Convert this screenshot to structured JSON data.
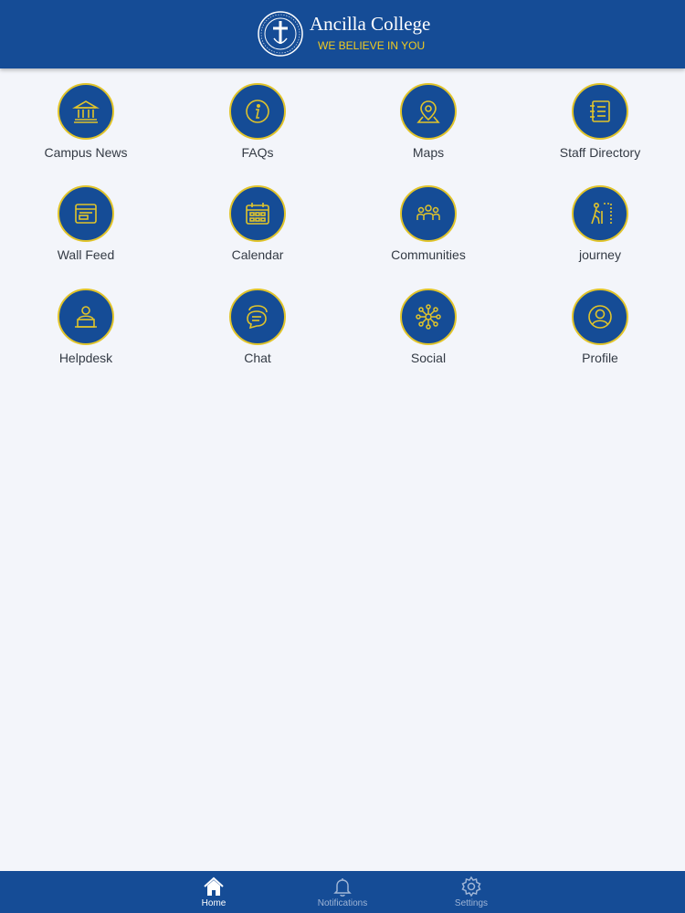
{
  "header": {
    "brand_title": "Ancilla College",
    "tagline": "WE BELIEVE IN YOU",
    "seal_text": "ANCILLA · DOMINI · COLLEGE",
    "colors": {
      "bar": "#154c96",
      "tagline": "#f2cc1f"
    }
  },
  "grid": {
    "accent_ring": "#e1c42a",
    "circle_fill": "#154c96",
    "items": [
      {
        "label": "Campus News",
        "icon": "bank-icon"
      },
      {
        "label": "FAQs",
        "icon": "info-icon"
      },
      {
        "label": "Maps",
        "icon": "map-pin-icon"
      },
      {
        "label": "Staff Directory",
        "icon": "address-book-icon"
      },
      {
        "label": "Wall Feed",
        "icon": "browser-window-icon"
      },
      {
        "label": "Calendar",
        "icon": "calendar-icon"
      },
      {
        "label": "Communities",
        "icon": "group-icon"
      },
      {
        "label": "journey",
        "icon": "hiker-icon"
      },
      {
        "label": "Helpdesk",
        "icon": "support-person-icon"
      },
      {
        "label": "Chat",
        "icon": "chat-bubbles-icon"
      },
      {
        "label": "Social",
        "icon": "network-icon"
      },
      {
        "label": "Profile",
        "icon": "user-circle-icon"
      }
    ]
  },
  "tabbar": {
    "active": "Home",
    "items": [
      {
        "label": "Home",
        "icon": "home-icon"
      },
      {
        "label": "Notifications",
        "icon": "bell-icon"
      },
      {
        "label": "Settings",
        "icon": "gear-icon"
      }
    ]
  }
}
